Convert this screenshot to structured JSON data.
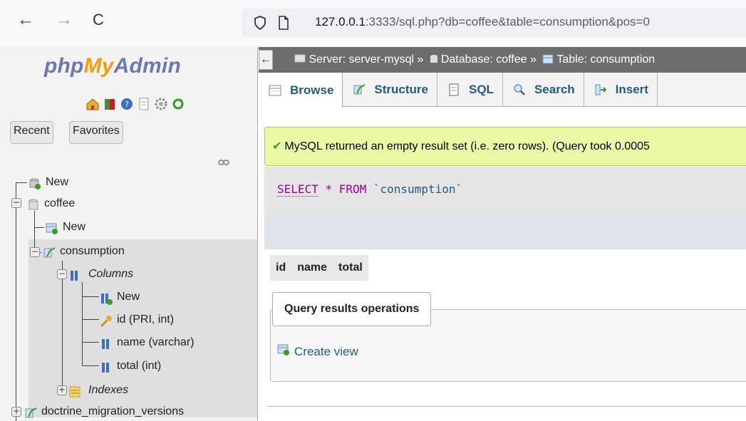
{
  "browser": {
    "url_host": "127.0.0.1",
    "url_rest": ":3333/sql.php?db=coffee&table=consumption&pos=0",
    "back_glyph": "←",
    "forward_glyph": "→",
    "reload_glyph": "C"
  },
  "sidebar": {
    "logo": {
      "php": "php",
      "my": "My",
      "admin": "Admin"
    },
    "tabs": [
      "Recent",
      "Favorites"
    ],
    "link_icon": "link-icon",
    "tree": {
      "new_db": "New",
      "db": "coffee",
      "new_table": "New",
      "table": "consumption",
      "columns_label": "Columns",
      "new_column": "New",
      "columns": [
        "id (PRI, int)",
        "name (varchar)",
        "total (int)"
      ],
      "indexes_label": "Indexes",
      "other_table": "doctrine_migration_versions"
    },
    "expand_symbol": "+",
    "collapse_symbol": "−"
  },
  "breadcrumb": {
    "collapse": "←",
    "server": "Server: server-mysql",
    "database": "Database: coffee",
    "table": "Table: consumption",
    "sep": "»"
  },
  "tabs": [
    "Browse",
    "Structure",
    "SQL",
    "Search",
    "Insert"
  ],
  "message": {
    "check": "✔",
    "text": "MySQL returned an empty result set (i.e. zero rows). (Query took 0.0005"
  },
  "sql": {
    "select": "SELECT",
    "star": "*",
    "from": "FROM",
    "table": "`consumption`"
  },
  "results": {
    "columns": [
      "id",
      "name",
      "total"
    ]
  },
  "operations": {
    "legend": "Query results operations",
    "create_view": "Create view"
  },
  "colors": {
    "accent": "#235a81",
    "success_bg": "#ebf8a4",
    "header_bg": "#6d6d6d"
  }
}
